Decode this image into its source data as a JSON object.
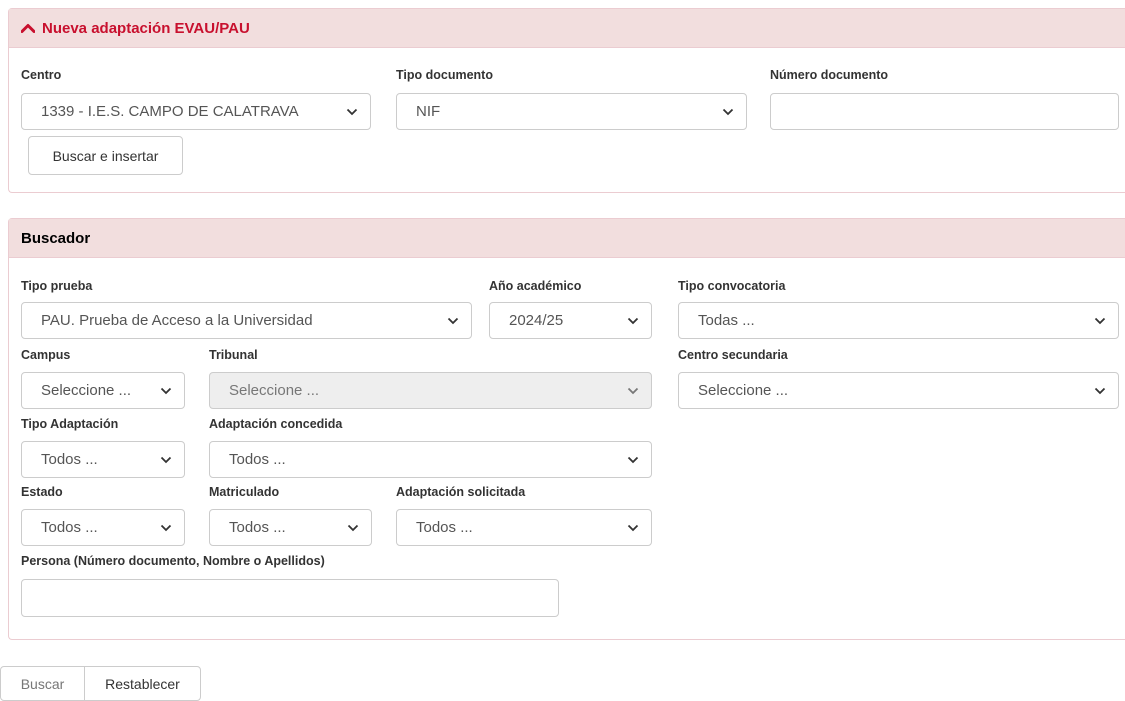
{
  "new_panel": {
    "title": "Nueva adaptación EVAU/PAU",
    "centro_label": "Centro",
    "centro_value": "1339 - I.E.S. CAMPO DE CALATRAVA",
    "tipo_documento_label": "Tipo documento",
    "tipo_documento_value": "NIF",
    "numero_documento_label": "Número documento",
    "numero_documento_value": "",
    "buscar_insertar_label": "Buscar e insertar"
  },
  "search_panel": {
    "title": "Buscador",
    "tipo_prueba_label": "Tipo prueba",
    "tipo_prueba_value": "PAU. Prueba de Acceso a la Universidad",
    "anio_label": "Año académico",
    "anio_value": "2024/25",
    "tipo_convocatoria_label": "Tipo convocatoria",
    "tipo_convocatoria_value": "Todas ...",
    "campus_label": "Campus",
    "campus_value": "Seleccione ...",
    "tribunal_label": "Tribunal",
    "tribunal_value": "Seleccione ...",
    "centro_secundaria_label": "Centro secundaria",
    "centro_secundaria_value": "Seleccione ...",
    "tipo_adaptacion_label": "Tipo Adaptación",
    "tipo_adaptacion_value": "Todos ...",
    "adaptacion_concedida_label": "Adaptación concedida",
    "adaptacion_concedida_value": "Todos ...",
    "estado_label": "Estado",
    "estado_value": "Todos ...",
    "matriculado_label": "Matriculado",
    "matriculado_value": "Todos ...",
    "adaptacion_solicitada_label": "Adaptación solicitada",
    "adaptacion_solicitada_value": "Todos ...",
    "persona_label": "Persona (Número documento, Nombre o Apellidos)",
    "persona_value": ""
  },
  "actions": {
    "buscar_label": "Buscar",
    "restablecer_label": "Restablecer"
  },
  "colors": {
    "accent": "#c7254e",
    "heading_bg": "#f2dede",
    "border": "#ebccd1"
  }
}
